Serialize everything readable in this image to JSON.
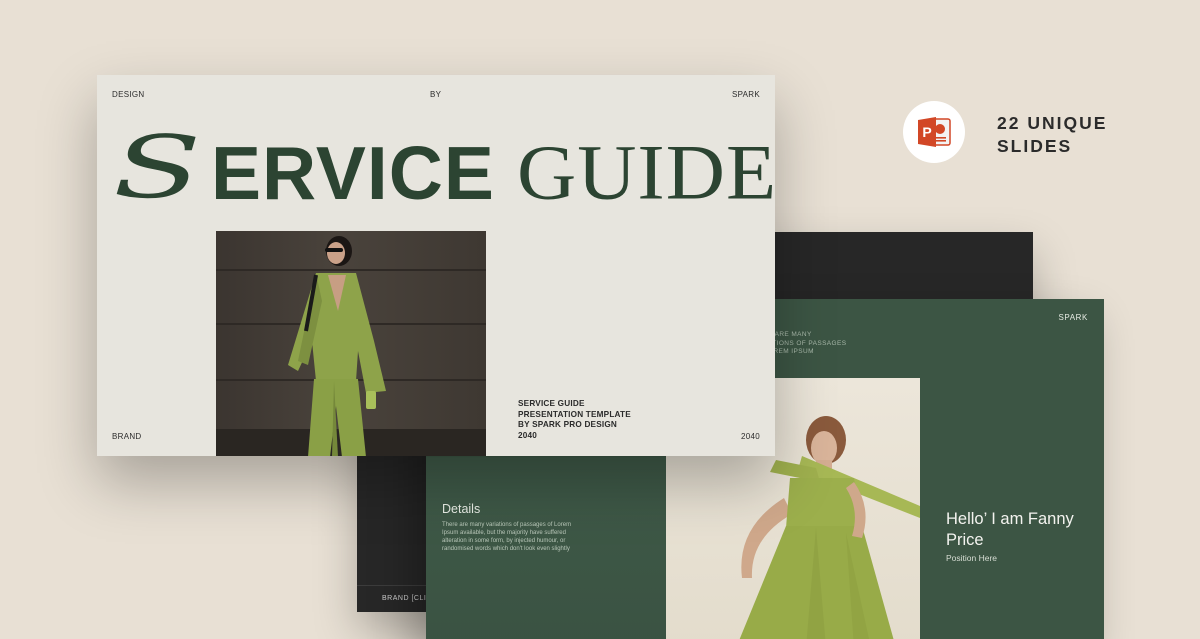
{
  "main_slide": {
    "top_left": "DESIGN",
    "top_center": "BY",
    "top_right": "SPARK",
    "title_first_letter": "S",
    "title_rest": "ERVICE",
    "title_second_word": "GUIDE",
    "description_lines": [
      "SERVICE GUIDE",
      "PRESENTATION TEMPLATE",
      "BY SPARK PRO DESIGN",
      "2040"
    ],
    "bottom_left": "BRAND",
    "bottom_right": "2040"
  },
  "dark_slide": {
    "footer_text": "BRAND  [CLIE"
  },
  "green_slide": {
    "top_right": "SPARK",
    "partial_text_lines": [
      "E ARE MANY",
      "ATIONS OF PASSAGES",
      "OREM IPSUM"
    ],
    "details_title": "Details",
    "details_body": "There are many variations of passages of Lorem Ipsum available, but the majority have suffered alteration in some form, by injected humour, or randomised words which don't look even slightly",
    "hello_text": "Hello’ I am Fanny Price",
    "position_text": "Position Here"
  },
  "badge": {
    "icon": "powerpoint-icon",
    "line1": "22 UNIQUE",
    "line2": "SLIDES"
  },
  "colors": {
    "background": "#e8e0d4",
    "title_green": "#2c4432",
    "slide_green": "#3c5544",
    "slide_dark": "#272727",
    "outfit_green": "#8ea34a",
    "powerpoint_orange": "#d24726"
  }
}
